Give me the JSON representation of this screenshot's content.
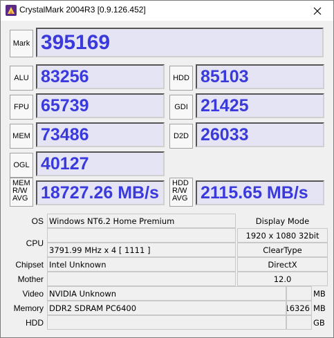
{
  "window": {
    "title": "CrystalMark 2004R3 [0.9.126.452]",
    "icon": "crystalmark-app-icon",
    "close_icon": "close-icon"
  },
  "scores": {
    "mark": {
      "label": "Mark",
      "value": "395169"
    },
    "alu": {
      "label": "ALU",
      "value": "83256"
    },
    "hdd": {
      "label": "HDD",
      "value": "85103"
    },
    "fpu": {
      "label": "FPU",
      "value": "65739"
    },
    "gdi": {
      "label": "GDI",
      "value": "21425"
    },
    "mem": {
      "label": "MEM",
      "value": "73486"
    },
    "d2d": {
      "label": "D2D",
      "value": "26033"
    },
    "ogl": {
      "label": "OGL",
      "value": "40127"
    },
    "mem_rw": {
      "label_l1": "MEM",
      "label_l2": "R/W",
      "label_l3": "AVG",
      "value": "18727.26 MB/s"
    },
    "hdd_rw": {
      "label_l1": "HDD",
      "label_l2": "R/W",
      "label_l3": "AVG",
      "value": "2115.65 MB/s"
    }
  },
  "info": {
    "os": {
      "label": "OS",
      "value": "Windows NT6.2 Home Premium"
    },
    "cpu": {
      "label": "CPU",
      "value_top": "",
      "value": "3791.99 MHz x 4 [ 1111 ]"
    },
    "chipset": {
      "label": "Chipset",
      "value": "Intel Unknown"
    },
    "mother": {
      "label": "Mother",
      "value": ""
    },
    "video": {
      "label": "Video",
      "value": "NVIDIA Unknown",
      "size": "",
      "unit": "MB"
    },
    "memory": {
      "label": "Memory",
      "value": "DDR2 SDRAM PC6400",
      "size": "16326",
      "unit": "MB"
    },
    "hdd": {
      "label": "HDD",
      "value": "",
      "size": "",
      "unit": "GB"
    }
  },
  "display": {
    "mode_label": "Display Mode",
    "mode_value": "1920 x 1080 32bit",
    "cleartype_label": "ClearType",
    "cleartype_value": "",
    "directx_label": "DirectX",
    "directx_value": "12.0"
  },
  "colors": {
    "score_text": "#3a3adc",
    "score_bg": "#e4e4f4"
  }
}
